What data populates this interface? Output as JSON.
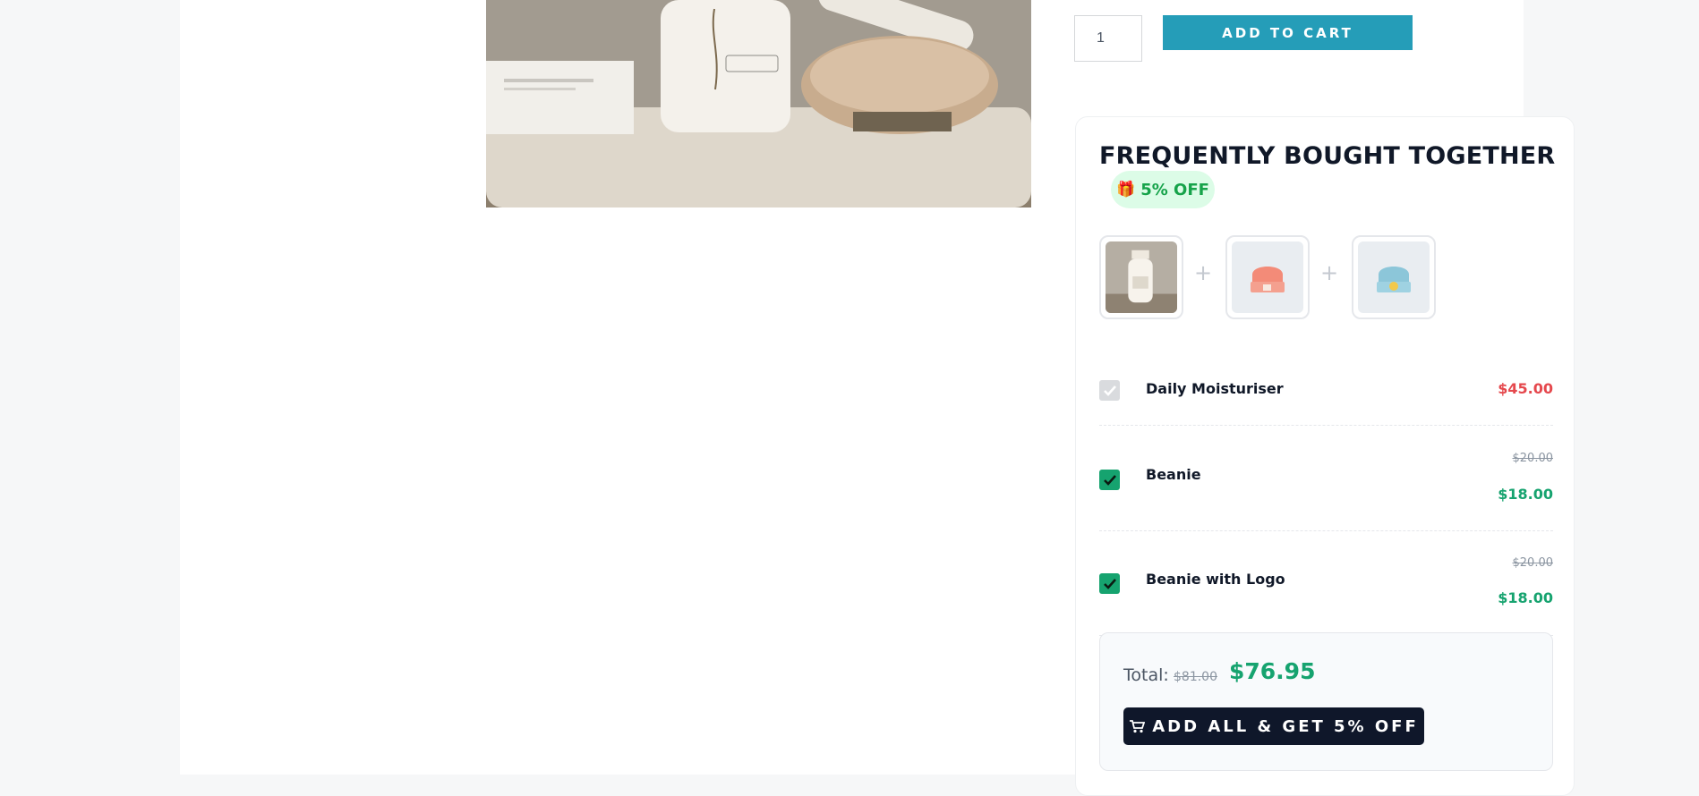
{
  "product": {
    "quantity": "1",
    "add_to_cart_label": "ADD TO CART"
  },
  "fbt": {
    "title": "FREQUENTLY BOUGHT TOGETHER",
    "badge": "5% OFF",
    "badge_icon": "gift-icon",
    "plus": "+",
    "items": [
      {
        "name": "Daily Moisturiser",
        "price": "$45.00",
        "checked": true,
        "disabled": true
      },
      {
        "name": "Beanie",
        "old_price": "$20.00",
        "new_price": "$18.00",
        "checked": true
      },
      {
        "name": "Beanie with Logo",
        "old_price": "$20.00",
        "new_price": "$18.00",
        "checked": true
      }
    ],
    "total": {
      "label": "Total:",
      "old_price": "$81.00",
      "new_price": "$76.95"
    },
    "add_all_label": "ADD ALL & GET 5% OFF",
    "add_all_icon": "cart-icon"
  },
  "colors": {
    "accent_teal": "#259db8",
    "price_red": "#e5484d",
    "price_green": "#16a36f",
    "dark_button": "#0f172a",
    "badge_bg": "#dcfce7"
  }
}
